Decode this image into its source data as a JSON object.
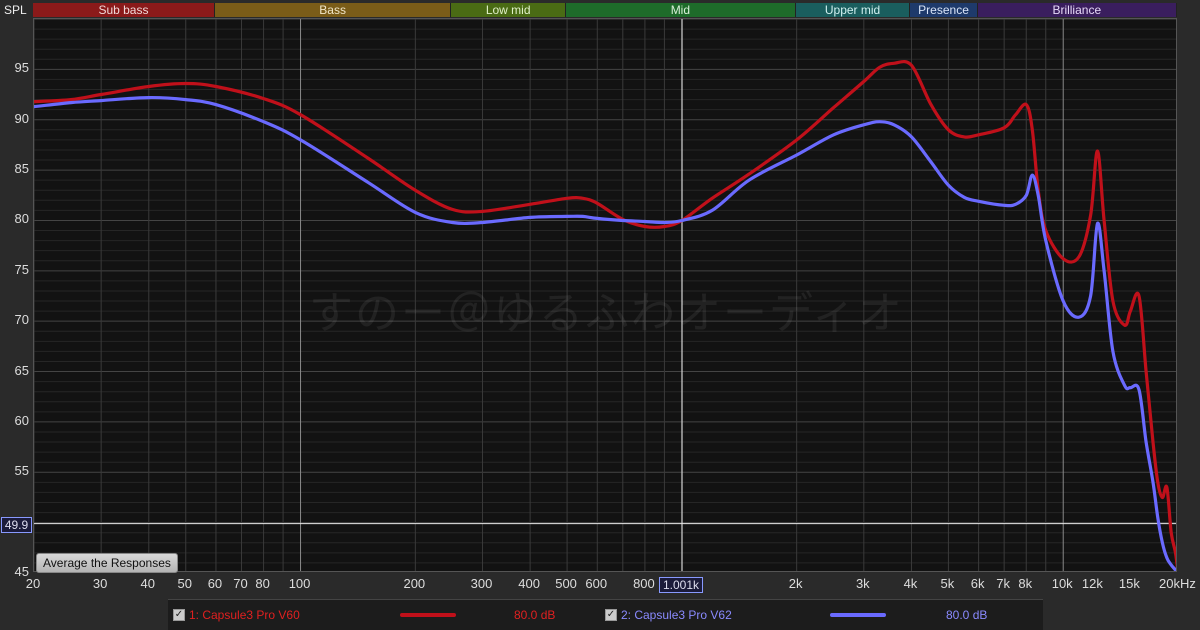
{
  "axis": {
    "y_title": "SPL",
    "x_unit_label": "20kHz"
  },
  "bands": [
    {
      "label": "Sub bass",
      "from": 20,
      "to": 60,
      "bg": "#8b1a1a",
      "fg": "#f0d8d8"
    },
    {
      "label": "Bass",
      "from": 60,
      "to": 250,
      "bg": "#7a5c18",
      "fg": "#f0e6c8"
    },
    {
      "label": "Low mid",
      "from": 250,
      "to": 500,
      "bg": "#4a6b14",
      "fg": "#e0f0c8"
    },
    {
      "label": "Mid",
      "from": 500,
      "to": 2000,
      "bg": "#1e6b2a",
      "fg": "#d8f0d8"
    },
    {
      "label": "Upper mid",
      "from": 2000,
      "to": 4000,
      "bg": "#1a5e5e",
      "fg": "#d0f0f0"
    },
    {
      "label": "Presence",
      "from": 4000,
      "to": 6000,
      "bg": "#1e3a6b",
      "fg": "#d8e4f8"
    },
    {
      "label": "Brilliance",
      "from": 6000,
      "to": 20000,
      "bg": "#3a1e5e",
      "fg": "#e6d8f8"
    }
  ],
  "cursor": {
    "y_label": "49.9",
    "x_label": "1.001k",
    "y_value": 49.9,
    "x_value": 1001
  },
  "button": {
    "average_label": "Average the Responses"
  },
  "watermark": "すのー＠ゆるふわオーディオ",
  "legend": [
    {
      "label": "1: Capsule3 Pro V60",
      "level": "80.0 dB",
      "color": "#c0101a"
    },
    {
      "label": "2: Capsule3 Pro V62",
      "level": "80.0 dB",
      "color": "#6a6aff"
    }
  ],
  "chart_data": {
    "type": "line",
    "xscale": "log",
    "xlim": [
      20,
      20000
    ],
    "ylim": [
      45,
      100
    ],
    "y_ticks": [
      45,
      50,
      55,
      60,
      65,
      70,
      75,
      80,
      85,
      90,
      95
    ],
    "y_tick_labels": [
      "45",
      "",
      "55",
      "60",
      "65",
      "70",
      "75",
      "80",
      "85",
      "90",
      "95"
    ],
    "x_ticks": [
      {
        "v": 20,
        "t": "20"
      },
      {
        "v": 30,
        "t": "30"
      },
      {
        "v": 40,
        "t": "40"
      },
      {
        "v": 50,
        "t": "50"
      },
      {
        "v": 60,
        "t": "60"
      },
      {
        "v": 70,
        "t": "70"
      },
      {
        "v": 80,
        "t": "80"
      },
      {
        "v": 100,
        "t": "100"
      },
      {
        "v": 200,
        "t": "200"
      },
      {
        "v": 300,
        "t": "300"
      },
      {
        "v": 400,
        "t": "400"
      },
      {
        "v": 500,
        "t": "500"
      },
      {
        "v": 600,
        "t": "600"
      },
      {
        "v": 800,
        "t": "800"
      },
      {
        "v": 2000,
        "t": "2k"
      },
      {
        "v": 3000,
        "t": "3k"
      },
      {
        "v": 4000,
        "t": "4k"
      },
      {
        "v": 5000,
        "t": "5k"
      },
      {
        "v": 6000,
        "t": "6k"
      },
      {
        "v": 7000,
        "t": "7k"
      },
      {
        "v": 8000,
        "t": "8k"
      },
      {
        "v": 10000,
        "t": "10k"
      },
      {
        "v": 12000,
        "t": "12k"
      },
      {
        "v": 15000,
        "t": "15k"
      }
    ],
    "series": [
      {
        "name": "1: Capsule3 Pro V60",
        "color": "#c0101a",
        "x": [
          20,
          25,
          30,
          40,
          50,
          60,
          80,
          100,
          150,
          200,
          250,
          300,
          400,
          500,
          550,
          600,
          700,
          800,
          900,
          1000,
          1200,
          1500,
          2000,
          2500,
          3000,
          3300,
          3600,
          4000,
          4500,
          5000,
          5500,
          6000,
          7000,
          7500,
          8000,
          8300,
          8600,
          9000,
          10000,
          11000,
          11800,
          12300,
          12800,
          13500,
          14500,
          15000,
          15800,
          16500,
          17200,
          17700,
          18200,
          18700,
          19200,
          19700,
          20000
        ],
        "y": [
          91.8,
          92.0,
          92.5,
          93.3,
          93.6,
          93.3,
          92.1,
          90.5,
          86.2,
          83.0,
          81.1,
          80.9,
          81.6,
          82.2,
          82.2,
          81.7,
          80.1,
          79.4,
          79.4,
          80.0,
          82.2,
          84.6,
          88.0,
          91.2,
          93.8,
          95.2,
          95.6,
          95.4,
          91.5,
          89.0,
          88.3,
          88.5,
          89.2,
          90.5,
          91.5,
          89.0,
          83.0,
          79.0,
          76.2,
          76.4,
          80.5,
          86.9,
          80.0,
          72.0,
          69.6,
          71.0,
          72.5,
          65.0,
          58.0,
          54.0,
          52.5,
          53.5,
          49.0,
          47.0,
          45.0
        ]
      },
      {
        "name": "2: Capsule3 Pro V62",
        "color": "#6a6aff",
        "x": [
          20,
          25,
          30,
          40,
          50,
          60,
          80,
          100,
          150,
          200,
          250,
          300,
          400,
          500,
          550,
          600,
          700,
          800,
          900,
          1000,
          1200,
          1500,
          2000,
          2500,
          3000,
          3300,
          3600,
          4000,
          4500,
          5000,
          5500,
          6000,
          7000,
          7500,
          8000,
          8300,
          8600,
          9000,
          10000,
          11000,
          11800,
          12300,
          12800,
          13500,
          14500,
          15000,
          15800,
          16500,
          17200,
          17700,
          18200,
          18700,
          19200,
          19700,
          20000
        ],
        "y": [
          91.3,
          91.7,
          91.9,
          92.2,
          92.0,
          91.5,
          89.8,
          88.0,
          83.8,
          80.8,
          79.8,
          79.8,
          80.3,
          80.4,
          80.4,
          80.2,
          80.0,
          79.9,
          79.8,
          80.0,
          81.0,
          84.0,
          86.5,
          88.5,
          89.5,
          89.8,
          89.5,
          88.3,
          85.8,
          83.5,
          82.3,
          81.9,
          81.5,
          81.6,
          82.5,
          84.5,
          82.5,
          78.0,
          72.0,
          70.4,
          72.5,
          79.7,
          75.0,
          67.0,
          63.6,
          63.4,
          63.2,
          58.0,
          54.0,
          50.5,
          48.0,
          46.5,
          45.8,
          45.3,
          45.0
        ]
      }
    ]
  }
}
